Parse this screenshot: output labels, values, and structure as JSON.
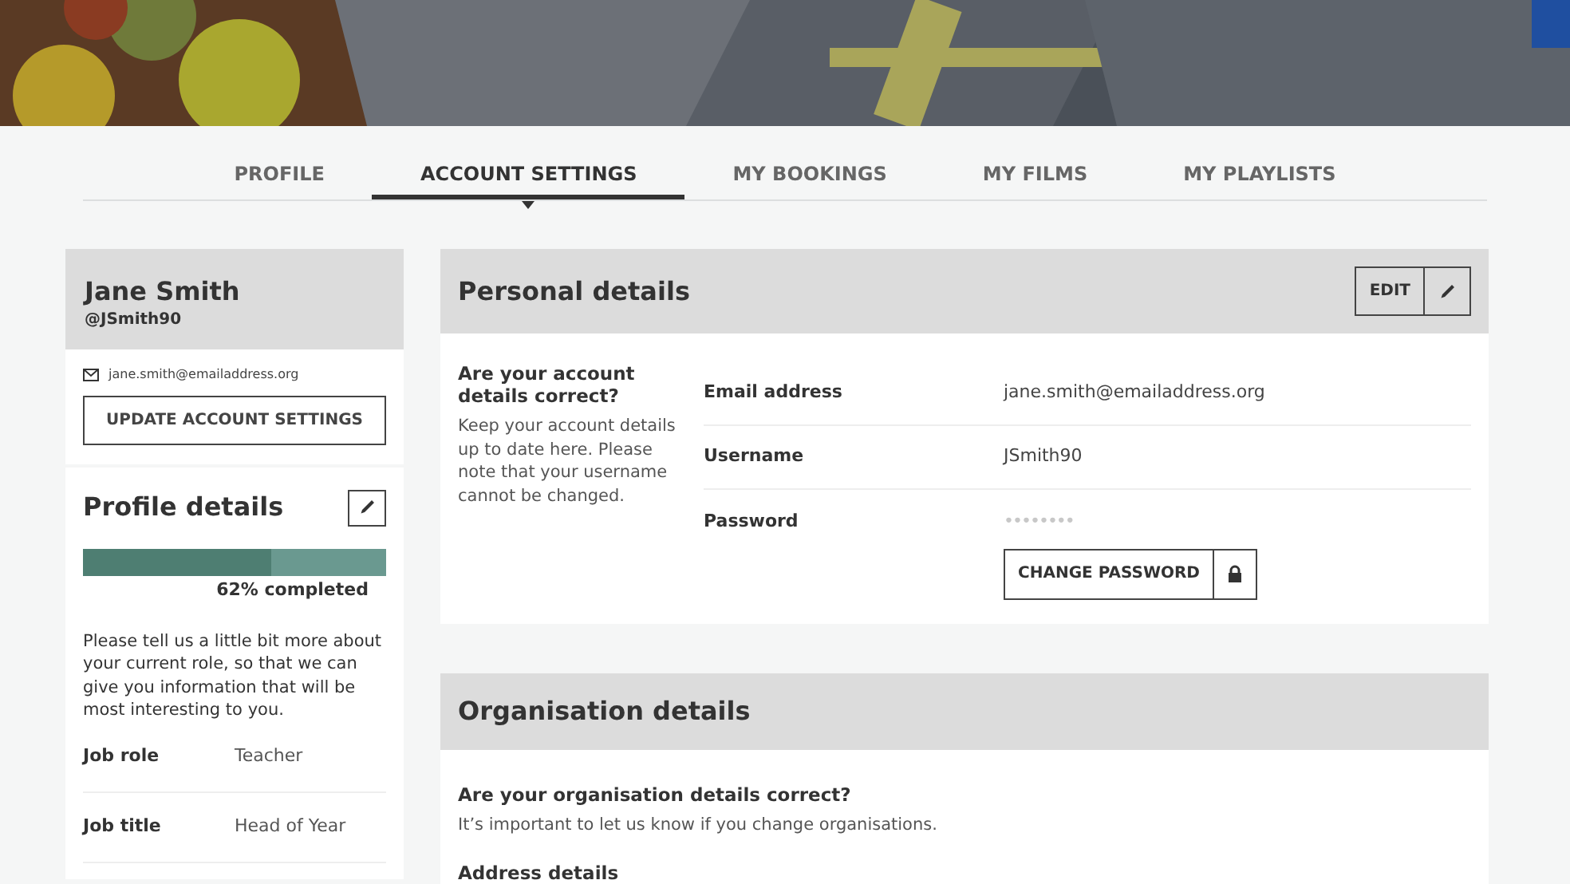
{
  "tabs": [
    {
      "label": "PROFILE",
      "selected": false
    },
    {
      "label": "ACCOUNT SETTINGS",
      "selected": true
    },
    {
      "label": "MY BOOKINGS",
      "selected": false
    },
    {
      "label": "MY FILMS",
      "selected": false
    },
    {
      "label": "MY PLAYLISTS",
      "selected": false
    }
  ],
  "account_card": {
    "name": "Jane Smith",
    "handle": "@JSmith90",
    "email": "jane.smith@emailaddress.org",
    "button": "UPDATE ACCOUNT SETTINGS"
  },
  "profile_card": {
    "title": "Profile details",
    "level": 0.62,
    "progress_label": "62% completed",
    "description": "Please tell us a little bit more about your current role, so that we can give you information that will be most interesting to you.",
    "fields": [
      {
        "label": "Job role",
        "value": "Teacher"
      },
      {
        "label": "Job title",
        "value": "Head of Year"
      }
    ]
  },
  "personal_details": {
    "title": "Personal details",
    "edit_button": "EDIT",
    "question": "Are your account details correct?",
    "help": "Keep your account details up to date here. Please note that your username cannot be changed.",
    "fields": [
      {
        "label": "Email address",
        "value": "jane.smith@emailaddress.org"
      },
      {
        "label": "Username",
        "value": "JSmith90"
      },
      {
        "label": "Password",
        "value": "••••••••"
      }
    ],
    "password_button": "CHANGE PASSWORD"
  },
  "organisation_details": {
    "title": "Organisation details",
    "question": "Are your organisation details correct?",
    "help": "It’s important to let us know if you change organisations.",
    "subheading": "Address details"
  }
}
